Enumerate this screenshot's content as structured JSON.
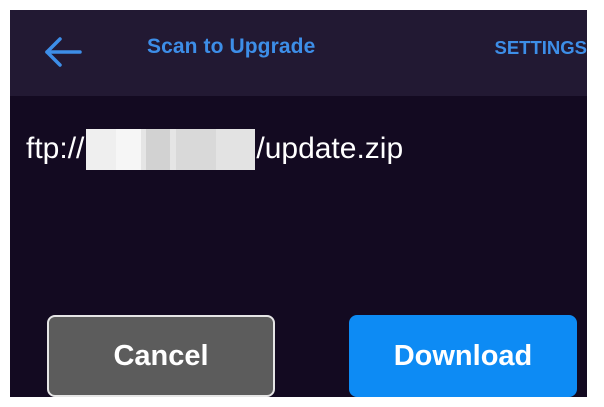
{
  "app_bar": {
    "back_icon": "arrow-left-icon",
    "title": "Scan to Upgrade",
    "settings_label": "SETTINGS"
  },
  "content": {
    "url_prefix": "ftp://",
    "url_redacted": true,
    "url_suffix": "/update.zip"
  },
  "actions": {
    "cancel_label": "Cancel",
    "download_label": "Download"
  },
  "colors": {
    "screen_background": "#130a21",
    "app_bar_background": "#221933",
    "accent": "#3d8ee8",
    "cancel_background": "#5c5c5c",
    "download_background": "#0d8bf4"
  }
}
